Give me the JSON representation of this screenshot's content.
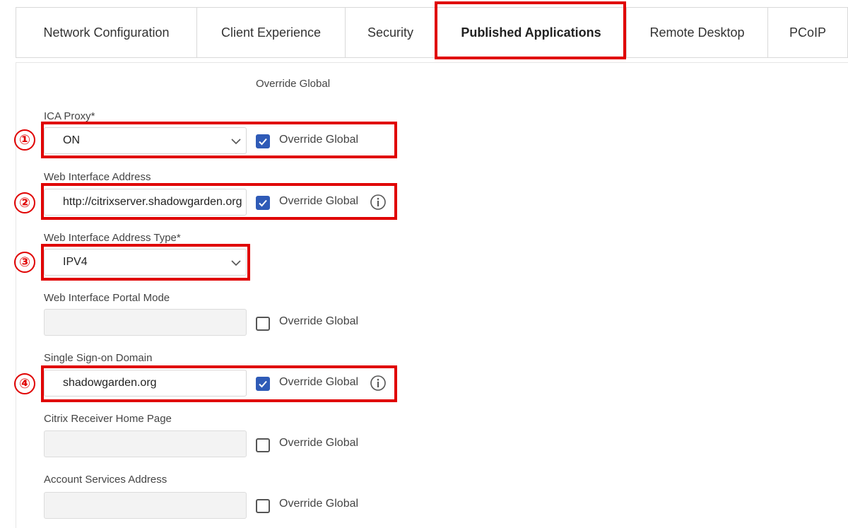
{
  "tabs": [
    {
      "label": "Network Configuration",
      "active": false
    },
    {
      "label": "Client Experience",
      "active": false
    },
    {
      "label": "Security",
      "active": false
    },
    {
      "label": "Published Applications",
      "active": true
    },
    {
      "label": "Remote Desktop",
      "active": false
    },
    {
      "label": "PCoIP",
      "active": false
    }
  ],
  "column_header": "Override Global",
  "fields": [
    {
      "label": "ICA Proxy*",
      "type": "select",
      "value": "ON",
      "override_label": "Override Global",
      "override_checked": true,
      "info": false,
      "marker": "①"
    },
    {
      "label": "Web Interface Address",
      "type": "text",
      "value": "http://citrixserver.shadowgarden.org",
      "override_label": "Override Global",
      "override_checked": true,
      "info": true,
      "marker": "②"
    },
    {
      "label": "Web Interface Address Type*",
      "type": "select",
      "value": "IPV4",
      "marker": "③"
    },
    {
      "label": "Web Interface Portal Mode",
      "type": "text",
      "value": "",
      "disabled": true,
      "override_label": "Override Global",
      "override_checked": false
    },
    {
      "label": "Single Sign-on Domain",
      "type": "text",
      "value": "shadowgarden.org",
      "override_label": "Override Global",
      "override_checked": true,
      "info": true,
      "marker": "④"
    },
    {
      "label": "Citrix Receiver Home Page",
      "type": "text",
      "value": "",
      "disabled": true,
      "override_label": "Override Global",
      "override_checked": false
    },
    {
      "label": "Account Services Address",
      "type": "text",
      "value": "",
      "disabled": true,
      "override_label": "Override Global",
      "override_checked": false
    }
  ],
  "colors": {
    "highlight": "#e00000",
    "checkbox_checked": "#2f5bb7"
  }
}
